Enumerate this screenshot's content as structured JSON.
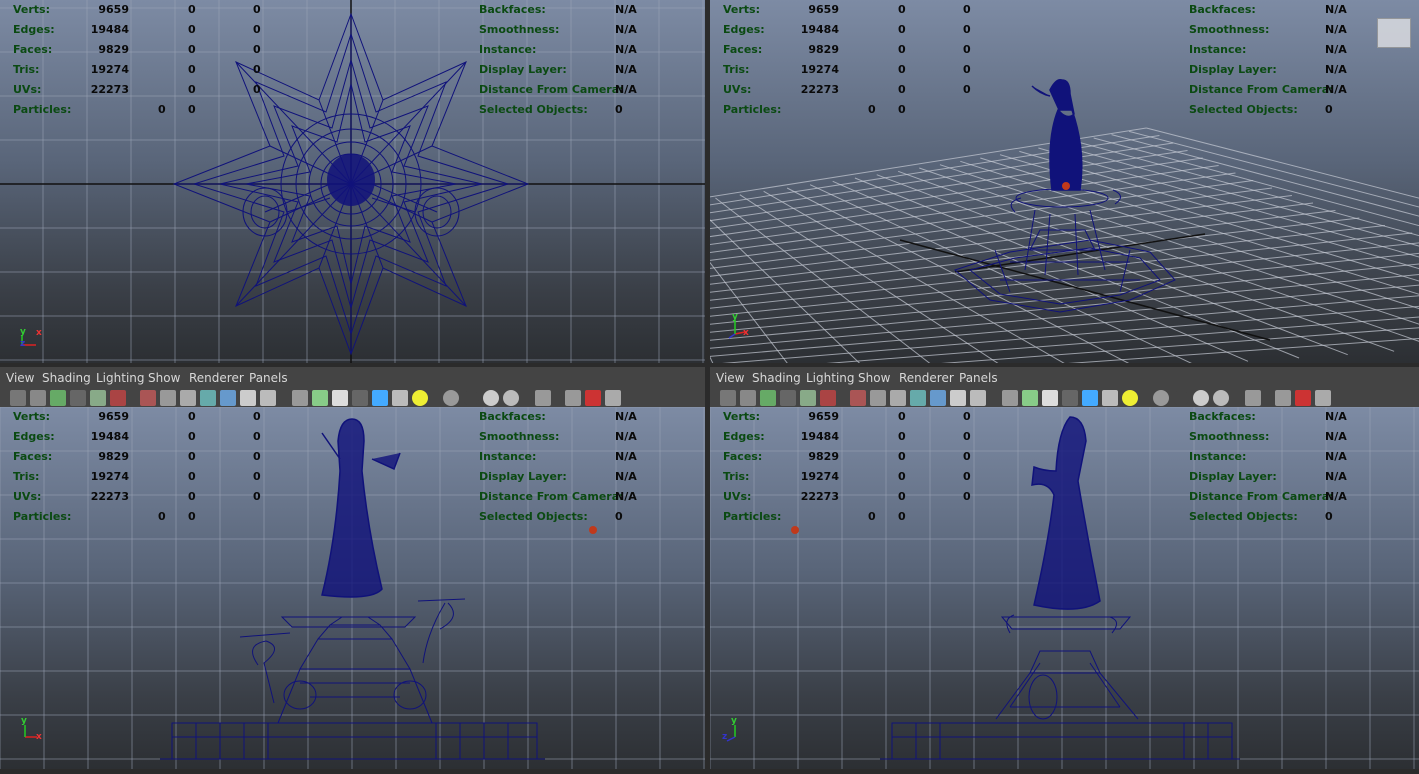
{
  "menu": [
    "View",
    "Shading",
    "Lighting",
    "Show",
    "Renderer",
    "Panels"
  ],
  "hud": {
    "left": [
      {
        "label": "Verts:",
        "a": "9659",
        "b": "0",
        "c": "0"
      },
      {
        "label": "Edges:",
        "a": "19484",
        "b": "0",
        "c": "0"
      },
      {
        "label": "Faces:",
        "a": "9829",
        "b": "0",
        "c": "0"
      },
      {
        "label": "Tris:",
        "a": "19274",
        "b": "0",
        "c": "0"
      },
      {
        "label": "UVs:",
        "a": "22273",
        "b": "0",
        "c": "0"
      }
    ],
    "particles": {
      "label": "Particles:",
      "a": "0",
      "b": "0"
    },
    "right": [
      {
        "label": "Backfaces:",
        "v": "N/A"
      },
      {
        "label": "Smoothness:",
        "v": "N/A"
      },
      {
        "label": "Instance:",
        "v": "N/A"
      },
      {
        "label": "Display Layer:",
        "v": "N/A"
      },
      {
        "label": "Distance From Camera:",
        "v": "N/A"
      },
      {
        "label": "Selected Objects:",
        "v": "0"
      }
    ]
  },
  "axis": {
    "x": "x",
    "y": "y",
    "z": "z"
  },
  "viewcube_label": "",
  "colors": {
    "wire": "#10127a",
    "label": "#0b4a12",
    "bg_top": "#7d8ba4",
    "bg_bottom": "#2c2f33",
    "menu_bg": "#444444",
    "light": "#c0391b"
  },
  "icons": [
    "camera-icon",
    "camera-attr-icon",
    "bookmark-icon",
    "image-plane-icon",
    "grid-icon",
    "film-gate-icon",
    "safe-action-icon",
    "resolution-gate-icon",
    "wireframe-icon",
    "smooth-shade-icon",
    "shade-wire-icon",
    "flat-icon",
    "default-light-icon",
    "textured-icon",
    "lights-icon",
    "shadows-icon",
    "xray-icon",
    "isolate-icon"
  ]
}
